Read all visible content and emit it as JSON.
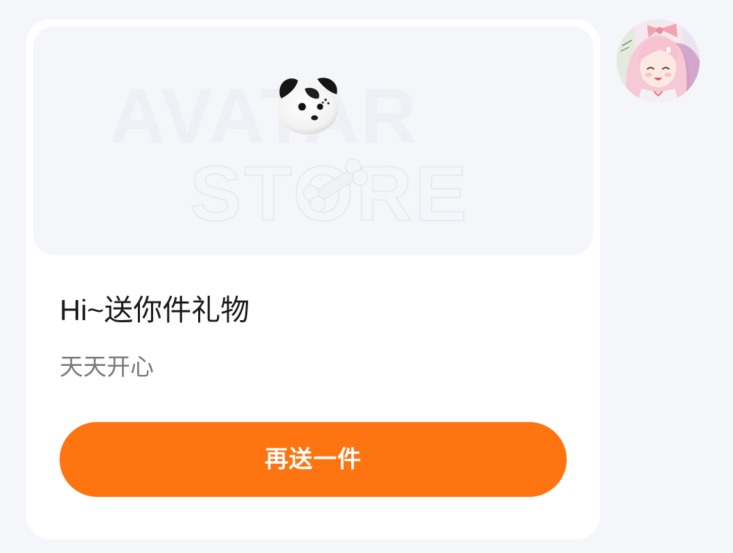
{
  "banner": {
    "watermark_line1": "AVATAR",
    "watermark_line2": "STORE"
  },
  "message": {
    "title": "Hi~送你件礼物",
    "subtitle": "天天开心"
  },
  "actions": {
    "send_again_label": "再送一件"
  },
  "colors": {
    "accent": "#fe7411",
    "page_background": "#f4f6f9",
    "card_background": "#ffffff",
    "banner_background": "#f4f6fa"
  },
  "icons": {
    "gift_primary": "dog-head-icon",
    "gift_secondary": "bone-icon"
  },
  "user": {
    "avatar": "anime-girl-avatar"
  }
}
